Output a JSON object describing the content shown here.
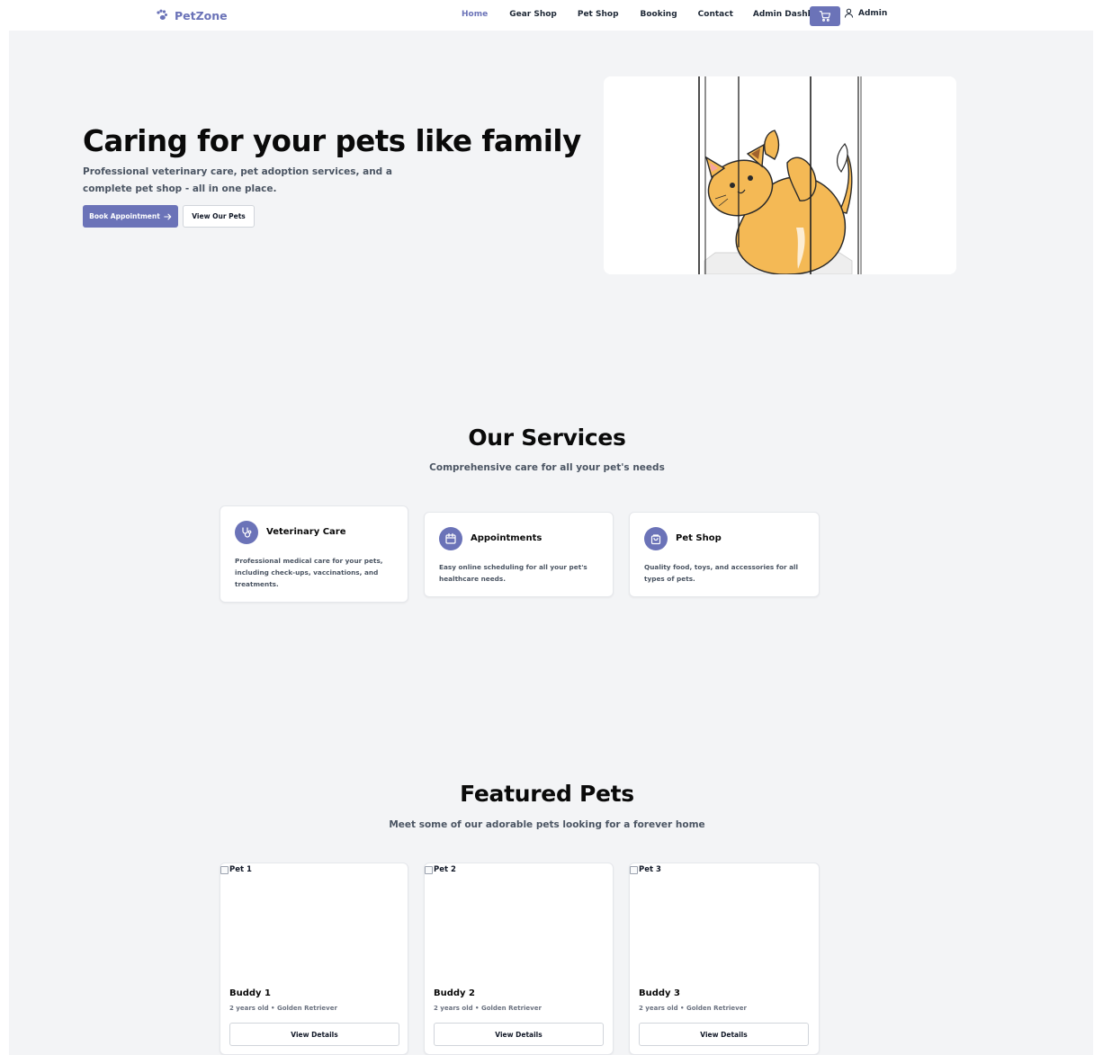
{
  "brand": {
    "name": "PetZone",
    "icon": "paw-icon",
    "color": "#6b73b8"
  },
  "nav": {
    "items": [
      {
        "label": "Home",
        "active": true
      },
      {
        "label": "Gear Shop",
        "active": false
      },
      {
        "label": "Pet Shop",
        "active": false
      },
      {
        "label": "Booking",
        "active": false
      },
      {
        "label": "Contact",
        "active": false
      },
      {
        "label": "Admin Dashboard",
        "active": false
      }
    ],
    "cart_icon": "cart-icon",
    "user_icon": "user-icon",
    "user_label": "Admin"
  },
  "hero": {
    "title": "Caring for your pets like family",
    "subtitle": "Professional veterinary care, pet adoption services, and a complete pet shop - all in one place.",
    "primary_button": "Book Appointment",
    "secondary_button": "View Our Pets"
  },
  "services": {
    "title": "Our Services",
    "subtitle": "Comprehensive care for all your pet's needs",
    "items": [
      {
        "icon": "stethoscope-icon",
        "title": "Veterinary Care",
        "description": "Professional medical care for your pets, including check-ups, vaccinations, and treatments."
      },
      {
        "icon": "calendar-icon",
        "title": "Appointments",
        "description": "Easy online scheduling for all your pet's healthcare needs."
      },
      {
        "icon": "shopping-bag-icon",
        "title": "Pet Shop",
        "description": "Quality food, toys, and accessories for all types of pets."
      }
    ]
  },
  "featured": {
    "title": "Featured Pets",
    "subtitle": "Meet some of our adorable pets looking for a forever home",
    "pets": [
      {
        "image_alt": "Pet 1",
        "name": "Buddy 1",
        "meta": "2 years old • Golden Retriever",
        "button": "View Details"
      },
      {
        "image_alt": "Pet 2",
        "name": "Buddy 2",
        "meta": "2 years old • Golden Retriever",
        "button": "View Details"
      },
      {
        "image_alt": "Pet 3",
        "name": "Buddy 3",
        "meta": "2 years old • Golden Retriever",
        "button": "View Details"
      }
    ]
  },
  "colors": {
    "accent": "#6b73b8",
    "background": "#f3f4f6",
    "text": "#0a0a0a",
    "muted": "#4b5563"
  }
}
